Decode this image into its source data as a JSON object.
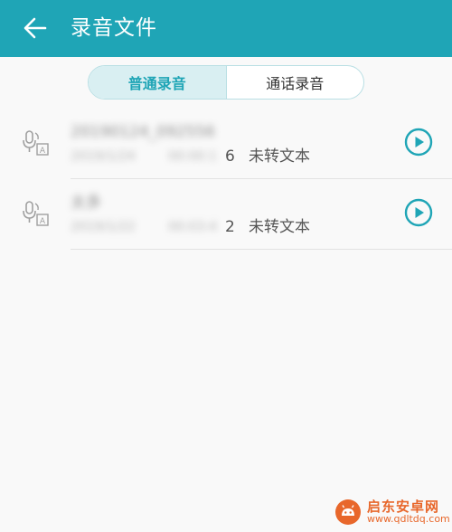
{
  "header": {
    "title": "录音文件",
    "back_icon": "back-arrow-icon"
  },
  "tabs": [
    {
      "label": "普通录音",
      "active": true
    },
    {
      "label": "通话录音",
      "active": false
    }
  ],
  "recordings": [
    {
      "name": "20190124_092556",
      "date": "2019/1/24",
      "duration_blurred": "00:00:1",
      "duration_visible": "6",
      "status": "未转文本"
    },
    {
      "name": "太多",
      "date": "2019/1/22",
      "duration_blurred": "00:03:4",
      "duration_visible": "2",
      "status": "未转文本"
    }
  ],
  "watermark": {
    "brand": "启东安卓网",
    "url": "www.qdltdq.com"
  },
  "colors": {
    "accent": "#1fa5b6",
    "tab_active_bg": "#d9eff2",
    "watermark": "#e8672b"
  }
}
